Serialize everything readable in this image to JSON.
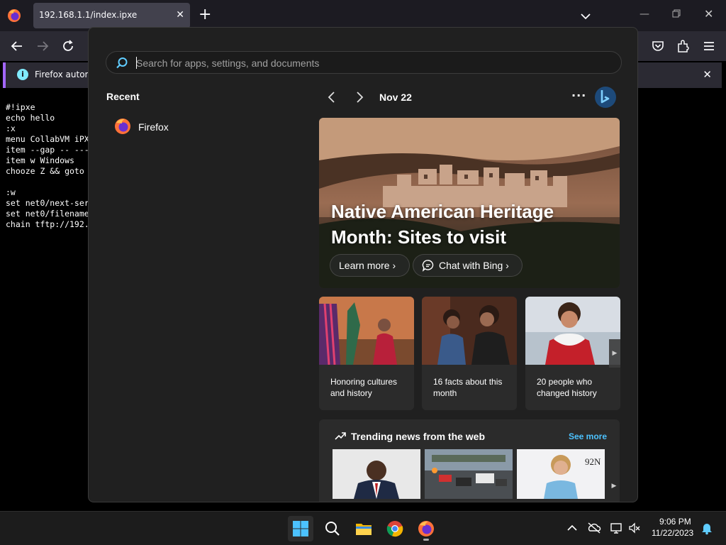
{
  "browser": {
    "tab_title": "192.168.1.1/index.ipxe",
    "notification_text": "Firefox automa"
  },
  "page": {
    "code_lines": [
      "#!ipxe",
      "echo hello",
      ":x",
      "menu CollabVM iPX",
      "item --gap -- ---",
      "item w Windows",
      "chooze Z && goto",
      "",
      ":w",
      "set net0/next-ser",
      "set net0/filename",
      "chain tftp://192."
    ]
  },
  "start_menu": {
    "search_placeholder": "Search for apps, settings, and documents",
    "recent_title": "Recent",
    "recent_items": [
      {
        "label": "Firefox",
        "icon": "firefox-icon"
      }
    ],
    "date": "Nov 22",
    "more": "···",
    "hero": {
      "title": "Native American Heritage Month: Sites to visit",
      "learn_more": "Learn more",
      "chat": "Chat with Bing"
    },
    "cards": [
      {
        "label": "Honoring cultures and history"
      },
      {
        "label": "16 facts about this month"
      },
      {
        "label": "20 people who changed history"
      }
    ],
    "trending": {
      "title": "Trending news from the web",
      "see_more": "See more"
    }
  },
  "taskbar": {
    "time": "9:06 PM",
    "date": "11/22/2023"
  },
  "colors": {
    "accent_link": "#4cc2ff",
    "notification_bar": "#a366ff",
    "start_bg": "#202020"
  }
}
